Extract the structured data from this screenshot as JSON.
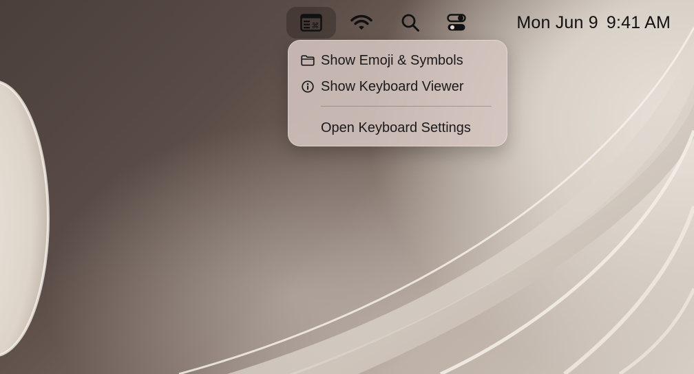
{
  "menubar": {
    "input_menu_icon": "keyboard-input-icon",
    "wifi_icon": "wifi-icon",
    "search_icon": "search-icon",
    "control_center_icon": "control-center-icon",
    "clock": {
      "date": "Mon Jun 9",
      "time": "9:41 AM"
    }
  },
  "input_menu": {
    "items": [
      {
        "label": "Show Emoji & Symbols",
        "icon": "folder-icon"
      },
      {
        "label": "Show Keyboard Viewer",
        "icon": "info-circle-icon"
      },
      {
        "label": "Open Keyboard Settings",
        "icon": ""
      }
    ]
  },
  "colors": {
    "menu_background": "#d6c6c1",
    "menubar_text": "#121212",
    "active_item_highlight": "#2a2220"
  }
}
